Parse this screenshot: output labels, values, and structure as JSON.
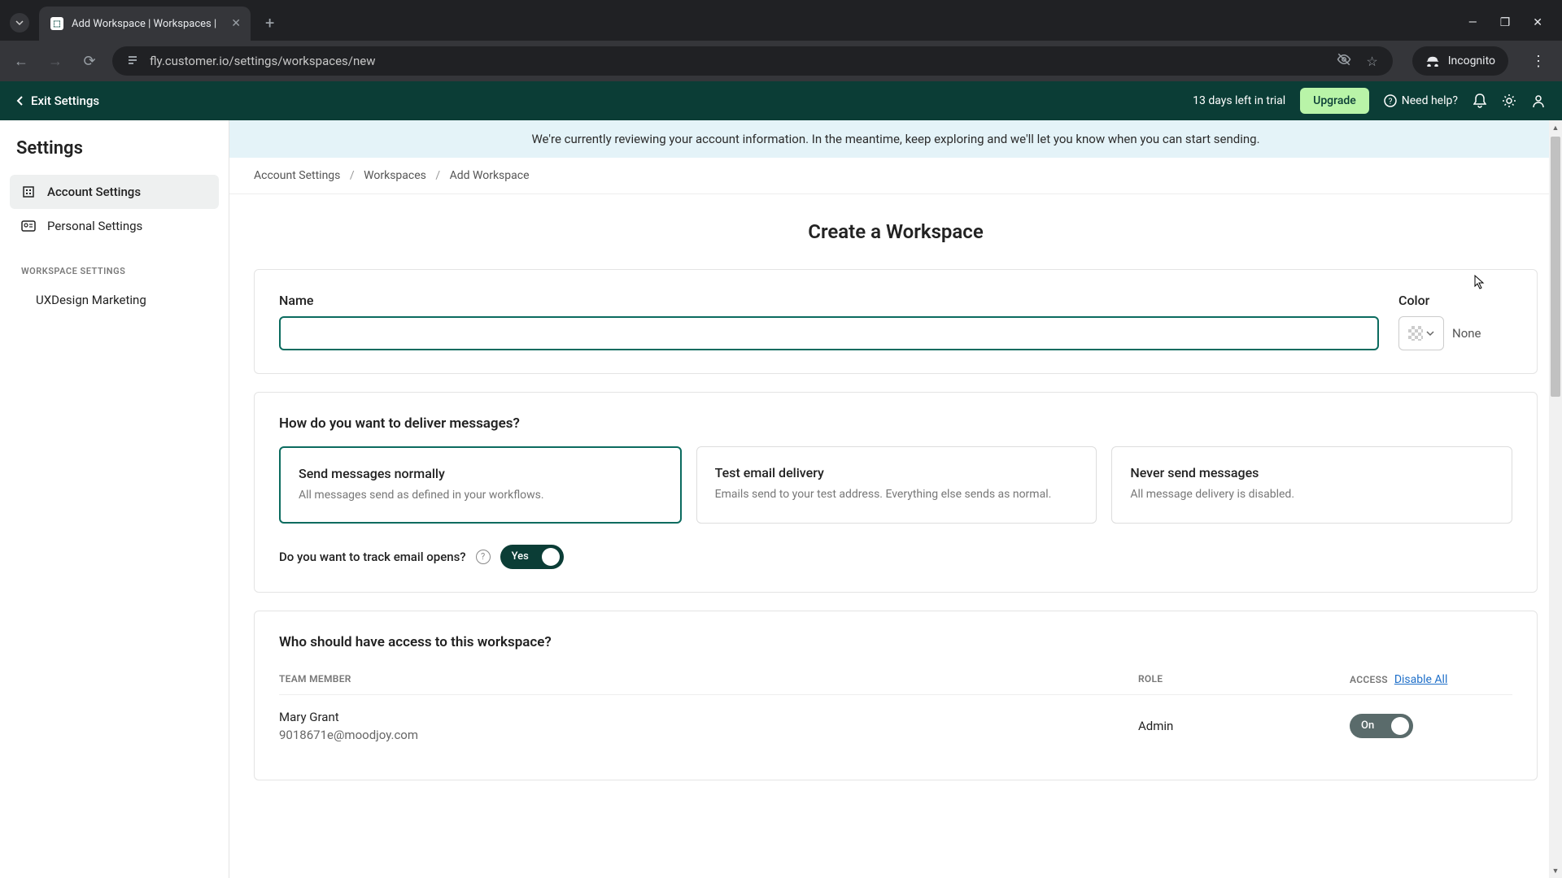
{
  "browser": {
    "tab_title": "Add Workspace | Workspaces |",
    "url": "fly.customer.io/settings/workspaces/new",
    "incognito_label": "Incognito"
  },
  "header": {
    "back_label": "Exit Settings",
    "trial_text": "13 days left in trial",
    "upgrade_label": "Upgrade",
    "help_label": "Need help?"
  },
  "sidebar": {
    "title": "Settings",
    "items": [
      {
        "label": "Account Settings"
      },
      {
        "label": "Personal Settings"
      }
    ],
    "section_label": "WORKSPACE SETTINGS",
    "workspace": "UXDesign Marketing"
  },
  "banner": "We're currently reviewing your account information. In the meantime, keep exploring and we'll let you know when you can start sending.",
  "breadcrumb": {
    "a": "Account Settings",
    "b": "Workspaces",
    "c": "Add Workspace"
  },
  "page": {
    "title": "Create a Workspace",
    "name_label": "Name",
    "color_label": "Color",
    "color_value": "None",
    "delivery_heading": "How do you want to deliver messages?",
    "options": [
      {
        "title": "Send messages normally",
        "desc": "All messages send as defined in your workflows."
      },
      {
        "title": "Test email delivery",
        "desc": "Emails send to your test address. Everything else sends as normal."
      },
      {
        "title": "Never send messages",
        "desc": "All message delivery is disabled."
      }
    ],
    "track_label": "Do you want to track email opens?",
    "track_toggle": "Yes",
    "access_heading": "Who should have access to this workspace?",
    "cols": {
      "member": "TEAM MEMBER",
      "role": "ROLE",
      "access": "ACCESS"
    },
    "disable_all": "Disable All",
    "members": [
      {
        "name": "Mary Grant",
        "email": "9018671e@moodjoy.com",
        "role": "Admin",
        "access": "On"
      }
    ]
  }
}
